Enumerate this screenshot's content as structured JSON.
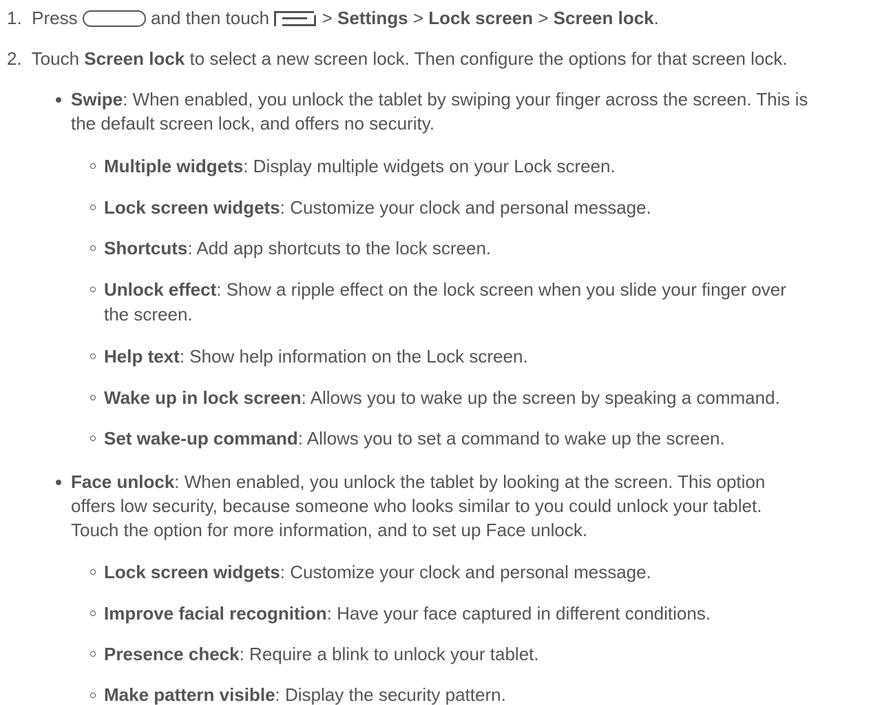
{
  "steps": [
    {
      "number": "1.",
      "pre": "Press",
      "mid": "and then touch",
      "p1": "Settings",
      "p2": "Lock screen",
      "p3": "Screen lock",
      "sep": ">",
      "end": "."
    },
    {
      "number": "2.",
      "a": "Touch",
      "b": "Screen lock",
      "c": "to select a new screen lock. Then configure the options for that screen lock."
    }
  ],
  "options": {
    "swipe": {
      "term": "Swipe",
      "line1": ": When enabled, you unlock the tablet by swiping your finger across the screen. This is",
      "line2": "the default screen lock, and offers no security.",
      "subs": [
        {
          "term": "Multiple widgets",
          "desc": ": Display multiple widgets on your Lock screen."
        },
        {
          "term": "Lock screen widgets",
          "desc": ": Customize your clock and personal message."
        },
        {
          "term": "Shortcuts",
          "desc": ": Add app shortcuts to the lock screen."
        },
        {
          "term": "Unlock effect",
          "desc": ":  Show a ripple effect on the lock screen when you slide your finger over",
          "desc2": "the screen."
        },
        {
          "term": "Help text",
          "desc": ": Show help information on the Lock screen."
        },
        {
          "term": "Wake up in lock screen",
          "desc": ": Allows you to wake up the screen by speaking a command."
        },
        {
          "term": "Set wake-up command",
          "desc": ": Allows you to set a command to wake up the screen."
        }
      ]
    },
    "face": {
      "term": "Face unlock",
      "line1": ": When enabled, you unlock the tablet by looking at the screen. This option",
      "line2": "offers low security, because someone who looks similar to you could unlock your tablet.",
      "line3": "Touch the option for more information, and to set up Face unlock.",
      "subs": [
        {
          "term": "Lock screen widgets",
          "desc": ": Customize your clock and personal message."
        },
        {
          "term": "Improve facial recognition",
          "desc": ": Have your face captured in different conditions."
        },
        {
          "term": "Presence check",
          "desc": ": Require a blink to unlock your tablet."
        },
        {
          "term": "Make pattern visible",
          "desc": ": Display the security pattern."
        }
      ]
    }
  },
  "icons": {
    "home": "home-key-icon",
    "menu": "menu-key-icon"
  }
}
